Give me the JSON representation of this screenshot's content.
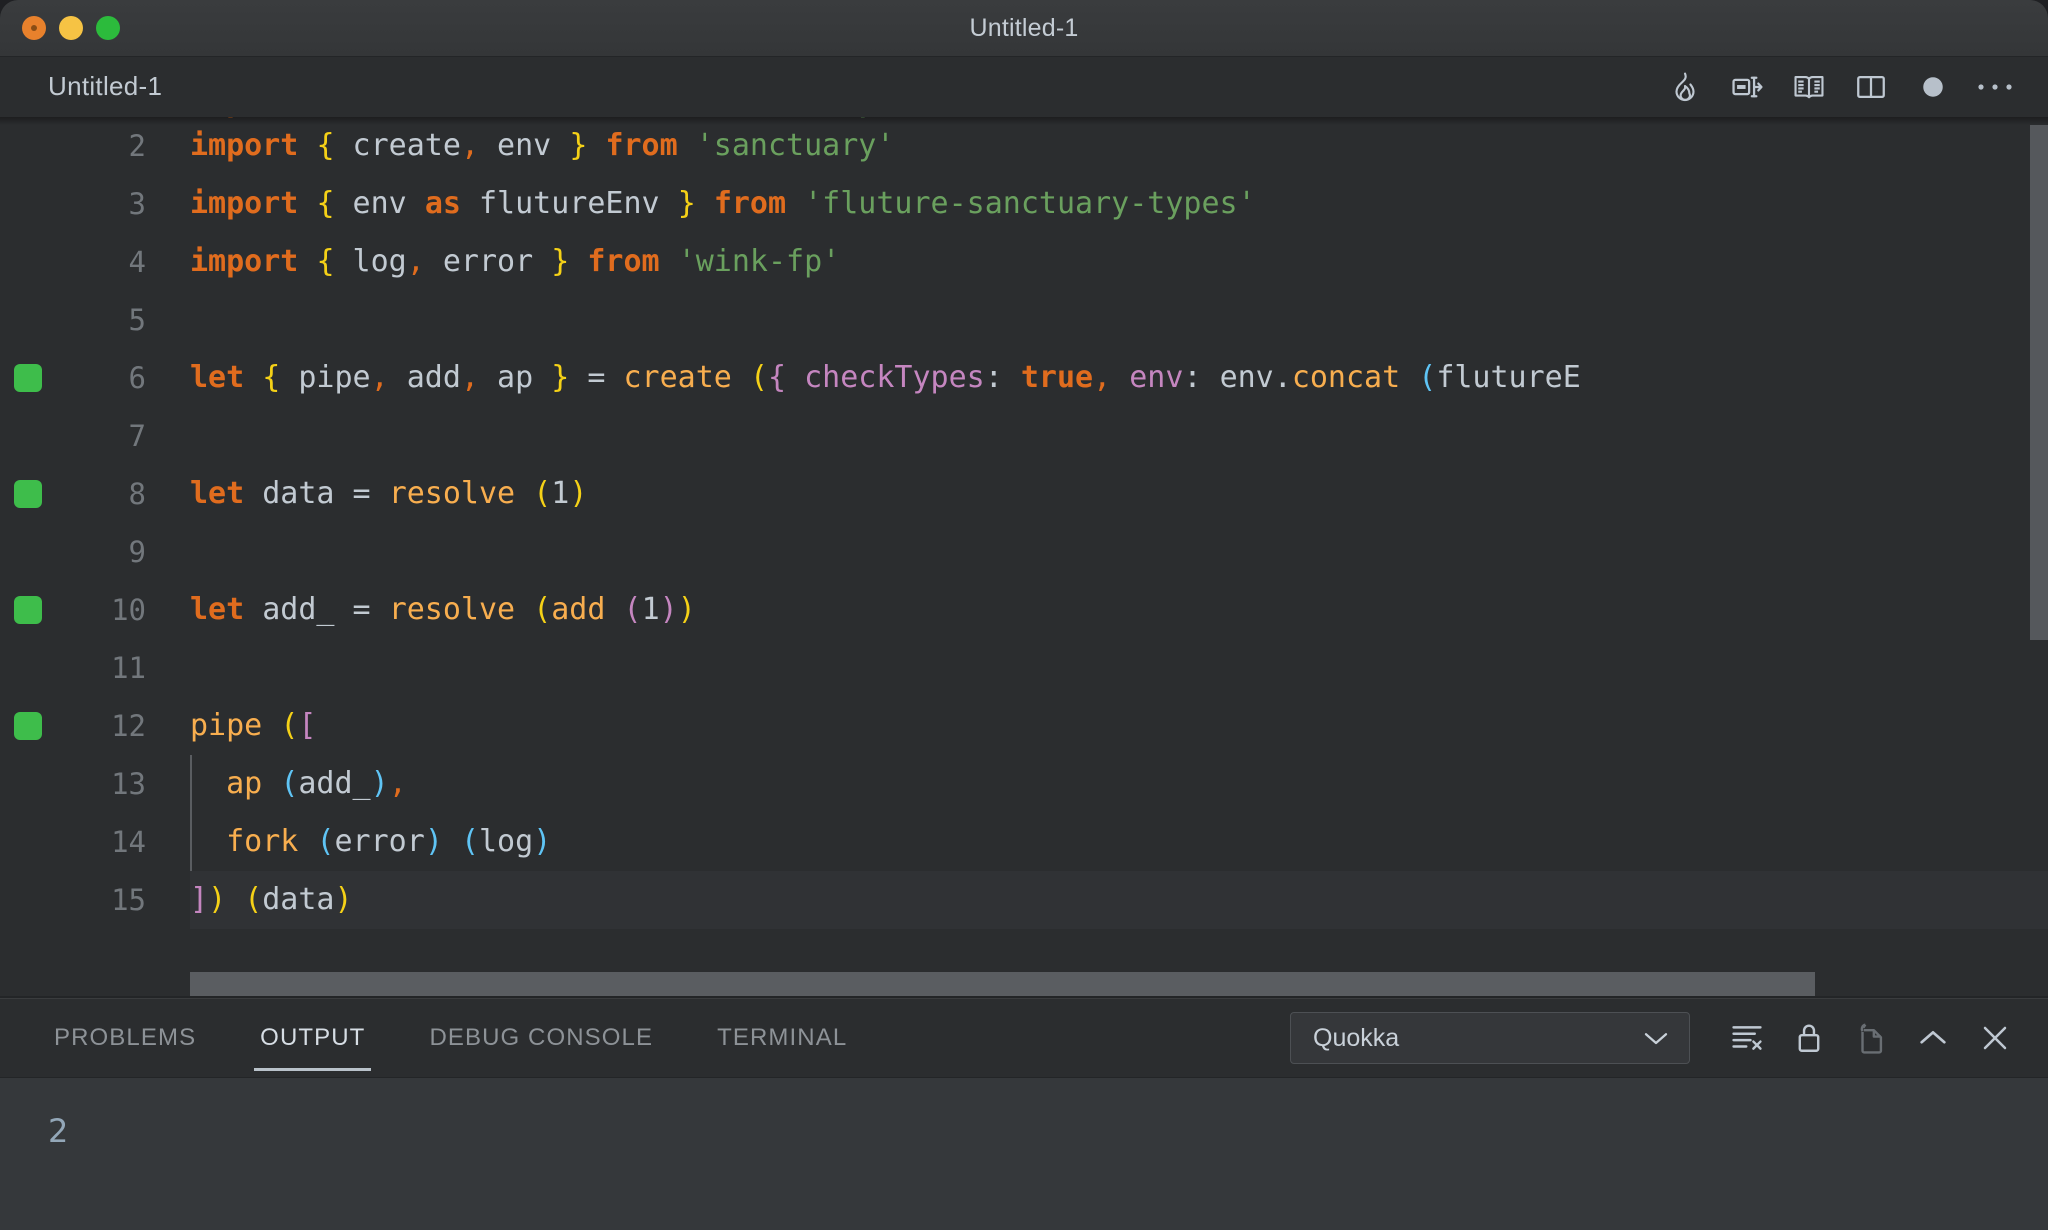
{
  "window": {
    "title": "Untitled-1",
    "traffic_lights": [
      "close-button",
      "minimize-button",
      "maximize-button"
    ]
  },
  "editor_tab": {
    "label": "Untitled-1",
    "actions": [
      {
        "name": "quokka-flame-icon",
        "label": "Start Quokka"
      },
      {
        "name": "rename-preview-icon",
        "label": "Open Preview to the Side"
      },
      {
        "name": "open-preview-icon",
        "label": "Open Preview"
      },
      {
        "name": "split-editor-icon",
        "label": "Split Editor"
      },
      {
        "name": "unsaved-dot-icon",
        "label": "Unsaved changes"
      },
      {
        "name": "more-actions-icon",
        "label": "More Actions..."
      }
    ]
  },
  "code": {
    "language": "javascript",
    "first_visible_line": 2,
    "current_line": 15,
    "lines": [
      {
        "number": 2,
        "run_marker": false,
        "tokens": [
          {
            "t": "import",
            "c": "t-key"
          },
          {
            "t": " ",
            "c": "t-id"
          },
          {
            "t": "{",
            "c": "t-b1"
          },
          {
            "t": " create",
            "c": "t-id"
          },
          {
            "t": ",",
            "c": "t-punc"
          },
          {
            "t": " env ",
            "c": "t-id"
          },
          {
            "t": "}",
            "c": "t-b1"
          },
          {
            "t": " ",
            "c": "t-id"
          },
          {
            "t": "from",
            "c": "t-key"
          },
          {
            "t": " ",
            "c": "t-id"
          },
          {
            "t": "'sanctuary'",
            "c": "t-str"
          }
        ]
      },
      {
        "number": 3,
        "run_marker": false,
        "tokens": [
          {
            "t": "import",
            "c": "t-key"
          },
          {
            "t": " ",
            "c": "t-id"
          },
          {
            "t": "{",
            "c": "t-b1"
          },
          {
            "t": " env ",
            "c": "t-id"
          },
          {
            "t": "as",
            "c": "t-key"
          },
          {
            "t": " flutureEnv ",
            "c": "t-id"
          },
          {
            "t": "}",
            "c": "t-b1"
          },
          {
            "t": " ",
            "c": "t-id"
          },
          {
            "t": "from",
            "c": "t-key"
          },
          {
            "t": " ",
            "c": "t-id"
          },
          {
            "t": "'fluture-sanctuary-types'",
            "c": "t-str"
          }
        ]
      },
      {
        "number": 4,
        "run_marker": false,
        "tokens": [
          {
            "t": "import",
            "c": "t-key"
          },
          {
            "t": " ",
            "c": "t-id"
          },
          {
            "t": "{",
            "c": "t-b1"
          },
          {
            "t": " log",
            "c": "t-id"
          },
          {
            "t": ",",
            "c": "t-punc"
          },
          {
            "t": " error ",
            "c": "t-id"
          },
          {
            "t": "}",
            "c": "t-b1"
          },
          {
            "t": " ",
            "c": "t-id"
          },
          {
            "t": "from",
            "c": "t-key"
          },
          {
            "t": " ",
            "c": "t-id"
          },
          {
            "t": "'wink-fp'",
            "c": "t-str"
          }
        ]
      },
      {
        "number": 5,
        "run_marker": false,
        "tokens": []
      },
      {
        "number": 6,
        "run_marker": true,
        "tokens": [
          {
            "t": "let",
            "c": "t-key"
          },
          {
            "t": " ",
            "c": "t-id"
          },
          {
            "t": "{",
            "c": "t-b1"
          },
          {
            "t": " pipe",
            "c": "t-id"
          },
          {
            "t": ",",
            "c": "t-punc"
          },
          {
            "t": " add",
            "c": "t-id"
          },
          {
            "t": ",",
            "c": "t-punc"
          },
          {
            "t": " ap ",
            "c": "t-id"
          },
          {
            "t": "}",
            "c": "t-b1"
          },
          {
            "t": " = ",
            "c": "t-id"
          },
          {
            "t": "create",
            "c": "t-fn"
          },
          {
            "t": " ",
            "c": "t-id"
          },
          {
            "t": "(",
            "c": "t-b1"
          },
          {
            "t": "{",
            "c": "t-b2"
          },
          {
            "t": " ",
            "c": "t-id"
          },
          {
            "t": "checkTypes",
            "c": "t-prop"
          },
          {
            "t": ": ",
            "c": "t-id"
          },
          {
            "t": "true",
            "c": "t-key"
          },
          {
            "t": ",",
            "c": "t-punc"
          },
          {
            "t": " ",
            "c": "t-id"
          },
          {
            "t": "env",
            "c": "t-prop"
          },
          {
            "t": ": ",
            "c": "t-id"
          },
          {
            "t": "env.",
            "c": "t-id"
          },
          {
            "t": "concat",
            "c": "t-fn"
          },
          {
            "t": " ",
            "c": "t-id"
          },
          {
            "t": "(",
            "c": "t-b3"
          },
          {
            "t": "flutureE",
            "c": "t-id"
          }
        ]
      },
      {
        "number": 7,
        "run_marker": false,
        "tokens": []
      },
      {
        "number": 8,
        "run_marker": true,
        "tokens": [
          {
            "t": "let",
            "c": "t-key"
          },
          {
            "t": " data = ",
            "c": "t-id"
          },
          {
            "t": "resolve",
            "c": "t-fn"
          },
          {
            "t": " ",
            "c": "t-id"
          },
          {
            "t": "(",
            "c": "t-b1"
          },
          {
            "t": "1",
            "c": "t-id"
          },
          {
            "t": ")",
            "c": "t-b1"
          }
        ]
      },
      {
        "number": 9,
        "run_marker": false,
        "tokens": []
      },
      {
        "number": 10,
        "run_marker": true,
        "tokens": [
          {
            "t": "let",
            "c": "t-key"
          },
          {
            "t": " add_ = ",
            "c": "t-id"
          },
          {
            "t": "resolve",
            "c": "t-fn"
          },
          {
            "t": " ",
            "c": "t-id"
          },
          {
            "t": "(",
            "c": "t-b1"
          },
          {
            "t": "add",
            "c": "t-fn"
          },
          {
            "t": " ",
            "c": "t-id"
          },
          {
            "t": "(",
            "c": "t-b2"
          },
          {
            "t": "1",
            "c": "t-id"
          },
          {
            "t": ")",
            "c": "t-b2"
          },
          {
            "t": ")",
            "c": "t-b1"
          }
        ]
      },
      {
        "number": 11,
        "run_marker": false,
        "tokens": []
      },
      {
        "number": 12,
        "run_marker": true,
        "tokens": [
          {
            "t": "pipe",
            "c": "t-fn"
          },
          {
            "t": " ",
            "c": "t-id"
          },
          {
            "t": "(",
            "c": "t-b1"
          },
          {
            "t": "[",
            "c": "t-b2"
          }
        ]
      },
      {
        "number": 13,
        "run_marker": false,
        "indent_guide": true,
        "tokens": [
          {
            "t": "  ",
            "c": "t-id"
          },
          {
            "t": "ap",
            "c": "t-fn"
          },
          {
            "t": " ",
            "c": "t-id"
          },
          {
            "t": "(",
            "c": "t-b3"
          },
          {
            "t": "add_",
            "c": "t-id"
          },
          {
            "t": ")",
            "c": "t-b3"
          },
          {
            "t": ",",
            "c": "t-punc"
          }
        ]
      },
      {
        "number": 14,
        "run_marker": false,
        "indent_guide": true,
        "tokens": [
          {
            "t": "  ",
            "c": "t-id"
          },
          {
            "t": "fork",
            "c": "t-fn"
          },
          {
            "t": " ",
            "c": "t-id"
          },
          {
            "t": "(",
            "c": "t-b3"
          },
          {
            "t": "error",
            "c": "t-id"
          },
          {
            "t": ")",
            "c": "t-b3"
          },
          {
            "t": " ",
            "c": "t-id"
          },
          {
            "t": "(",
            "c": "t-b3"
          },
          {
            "t": "log",
            "c": "t-id"
          },
          {
            "t": ")",
            "c": "t-b3"
          }
        ]
      },
      {
        "number": 15,
        "run_marker": false,
        "current": true,
        "tokens": [
          {
            "t": "]",
            "c": "t-b2"
          },
          {
            "t": ")",
            "c": "t-b1"
          },
          {
            "t": " ",
            "c": "t-id"
          },
          {
            "t": "(",
            "c": "t-b1"
          },
          {
            "t": "data",
            "c": "t-id"
          },
          {
            "t": ")",
            "c": "t-b1"
          }
        ]
      }
    ]
  },
  "panel": {
    "tabs": [
      {
        "label": "PROBLEMS",
        "active": false
      },
      {
        "label": "OUTPUT",
        "active": true
      },
      {
        "label": "DEBUG CONSOLE",
        "active": false
      },
      {
        "label": "TERMINAL",
        "active": false
      }
    ],
    "channel_select": {
      "value": "Quokka"
    },
    "actions": [
      {
        "name": "clear-output-icon",
        "label": "Clear Output",
        "dim": false
      },
      {
        "name": "lock-scroll-icon",
        "label": "Turn Auto Scrolling Off",
        "dim": false
      },
      {
        "name": "open-in-editor-icon",
        "label": "Open Output in Editor",
        "dim": true
      },
      {
        "name": "maximize-panel-icon",
        "label": "Maximize Panel Size",
        "dim": false
      },
      {
        "name": "close-panel-icon",
        "label": "Close Panel",
        "dim": false
      }
    ],
    "output_lines": [
      "2"
    ]
  },
  "colors": {
    "window_chrome": "#3a3c3e",
    "editor_bg": "#2b2d2f",
    "panel_output_bg": "#35383b",
    "keyword": "#e06c1e",
    "string": "#6aa05e",
    "function": "#f8ae4f",
    "property": "#c586c0",
    "bracket_1": "#f5d117",
    "bracket_2": "#c586c0",
    "bracket_3": "#5fc4f5",
    "identifier": "#c2cad2",
    "quokka_run_marker": "#3ebd4b",
    "output_text": "#93a7b8",
    "traffic_close": "#e8812c",
    "traffic_min": "#f6c344",
    "traffic_max": "#2cbb3c"
  }
}
